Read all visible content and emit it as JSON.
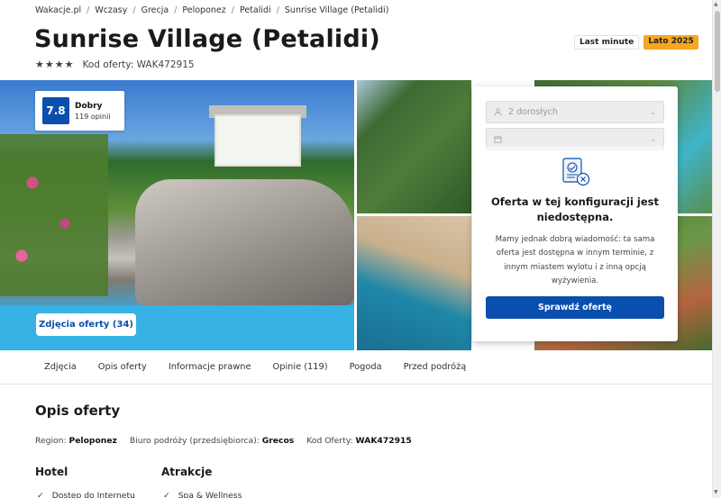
{
  "breadcrumb": [
    "Wakacje.pl",
    "Wczasy",
    "Grecja",
    "Peloponez",
    "Petalidi",
    "Sunrise Village (Petalidi)"
  ],
  "breadcrumb_separator": "/",
  "title": "Sunrise Village (Petalidi)",
  "badges": {
    "last_minute": "Last minute",
    "season": "Lato 2025"
  },
  "stars": 4,
  "offer_code_text": "Kod oferty: WAK472915",
  "score": {
    "value": "7.8",
    "label": "Dobry",
    "count": "119 opinii"
  },
  "photos_button": "Zdjęcia oferty (34)",
  "booking": {
    "guests": "2 dorosłych",
    "dates": "",
    "unavailable_title": "Oferta w tej konfiguracji jest niedostępna.",
    "unavailable_desc": "Mamy jednak dobrą wiadomość: ta sama oferta jest dostępna w innym terminie, z innym miastem wylotu i z inną opcją wyżywienia.",
    "check_button": "Sprawdź ofertę"
  },
  "tabs": [
    "Zdjęcia",
    "Opis oferty",
    "Informacje prawne",
    "Opinie (119)",
    "Pogoda",
    "Przed podróżą"
  ],
  "description": {
    "title": "Opis oferty",
    "region_label": "Region:",
    "region_value": "Peloponez",
    "agency_label": "Biuro podróży (przedsiębiorca):",
    "agency_value": "Grecos",
    "code_label": "Kod Oferty:",
    "code_value": "WAK472915"
  },
  "columns": [
    {
      "title": "Hotel",
      "items": [
        "Dostęp do Internetu"
      ]
    },
    {
      "title": "Atrakcje",
      "items": [
        "Spa & Wellness"
      ]
    }
  ],
  "colors": {
    "primary": "#0a4fae",
    "season_badge": "#f5a623"
  }
}
